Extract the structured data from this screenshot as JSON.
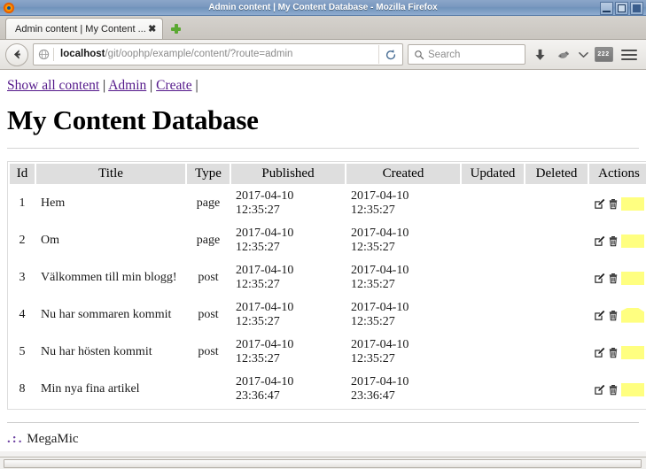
{
  "window": {
    "title": "Admin content | My Content Database - Mozilla Firefox",
    "app_icon": "firefox-icon",
    "controls": {
      "minimize": "minimize-button",
      "maximize": "maximize-button",
      "close": "close-button"
    }
  },
  "tabbar": {
    "tabs": [
      {
        "label": "Admin content | My Content ...",
        "close": "✖"
      }
    ],
    "new_tab_label": "+"
  },
  "toolbar": {
    "back_label": "←",
    "url": {
      "host": "localhost",
      "path": "/git/oophp/example/content/?route=admin",
      "full": "localhost/git/oophp/example/content/?route=admin"
    },
    "reload_label": "⟳",
    "search_placeholder": "Search",
    "downloads_icon": "download-arrow-icon",
    "sync_icon": "sync-icon",
    "chevron_icon": "chevron-down-icon",
    "badge_label": "222",
    "menu_icon": "hamburger-menu-icon"
  },
  "page": {
    "nav": {
      "links": [
        {
          "label": "Show all content"
        },
        {
          "label": "Admin"
        },
        {
          "label": "Create"
        }
      ],
      "separator": "|"
    },
    "title": "My Content Database",
    "table": {
      "columns": [
        "Id",
        "Title",
        "Type",
        "Published",
        "Created",
        "Updated",
        "Deleted",
        "Actions"
      ],
      "rows": [
        {
          "id": "1",
          "title": "Hem",
          "type": "page",
          "published": "2017-04-10 12:35:27",
          "published_date": "2017-04-10",
          "published_time": "12:35:27",
          "created_date": "2017-04-10",
          "created_time": "12:35:27",
          "updated": "",
          "deleted": "",
          "actions": {
            "edit": "edit-icon",
            "delete": "trash-icon",
            "highlight": "#ffff80"
          }
        },
        {
          "id": "2",
          "title": "Om",
          "type": "page",
          "published_date": "2017-04-10",
          "published_time": "12:35:27",
          "created_date": "2017-04-10",
          "created_time": "12:35:27",
          "updated": "",
          "deleted": "",
          "actions": {
            "edit": "edit-icon",
            "delete": "trash-icon",
            "highlight": "#ffff80"
          }
        },
        {
          "id": "3",
          "title": "Välkommen till min blogg!",
          "type": "post",
          "published_date": "2017-04-10",
          "published_time": "12:35:27",
          "created_date": "2017-04-10",
          "created_time": "12:35:27",
          "updated": "",
          "deleted": "",
          "actions": {
            "edit": "edit-icon",
            "delete": "trash-icon",
            "highlight": "#ffff80"
          }
        },
        {
          "id": "4",
          "title": "Nu har sommaren kommit",
          "type": "post",
          "published_date": "2017-04-10",
          "published_time": "12:35:27",
          "created_date": "2017-04-10",
          "created_time": "12:35:27",
          "updated": "",
          "deleted": "",
          "actions": {
            "edit": "edit-icon",
            "delete": "trash-icon",
            "highlight": "#ffff80"
          }
        },
        {
          "id": "5",
          "title": "Nu har hösten kommit",
          "type": "post",
          "published_date": "2017-04-10",
          "published_time": "12:35:27",
          "created_date": "2017-04-10",
          "created_time": "12:35:27",
          "updated": "",
          "deleted": "",
          "actions": {
            "edit": "edit-icon",
            "delete": "trash-icon",
            "highlight": "#ffff80"
          }
        },
        {
          "id": "8",
          "title": "Min nya fina artikel",
          "type": "",
          "published_date": "2017-04-10",
          "published_time": "23:36:47",
          "created_date": "2017-04-10",
          "created_time": "23:36:47",
          "updated": "",
          "deleted": "",
          "actions": {
            "edit": "edit-icon",
            "delete": "trash-icon",
            "highlight": "#ffff80"
          }
        }
      ]
    },
    "footer": {
      "dots": ".:.",
      "text": "MegaMic"
    }
  },
  "colors": {
    "link": "#551a8b",
    "header_bg": "#dedede",
    "highlight": "#ffff80",
    "titlebar": "#7a98bf"
  }
}
